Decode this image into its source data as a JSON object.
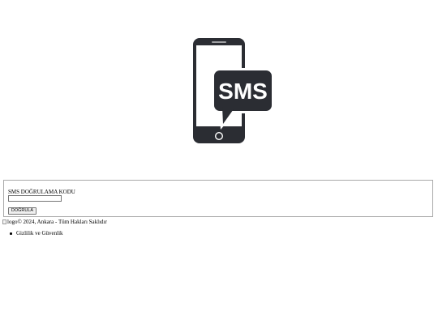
{
  "hero": {
    "icon": "sms-phone-icon",
    "badge_text": "SMS",
    "colors": {
      "dark": "#2b2d33",
      "screen": "#ffffff"
    }
  },
  "form": {
    "label": "SMS DOĞRULAMA KODU",
    "input_value": "",
    "submit_label": "DOĞRULA"
  },
  "footer": {
    "logo_alt": "logo",
    "copyright": "© 2024, Ankara - Tüm Hakları Saklıdır"
  },
  "links": [
    {
      "label": "Gizlilik ve Güvenlik"
    }
  ]
}
